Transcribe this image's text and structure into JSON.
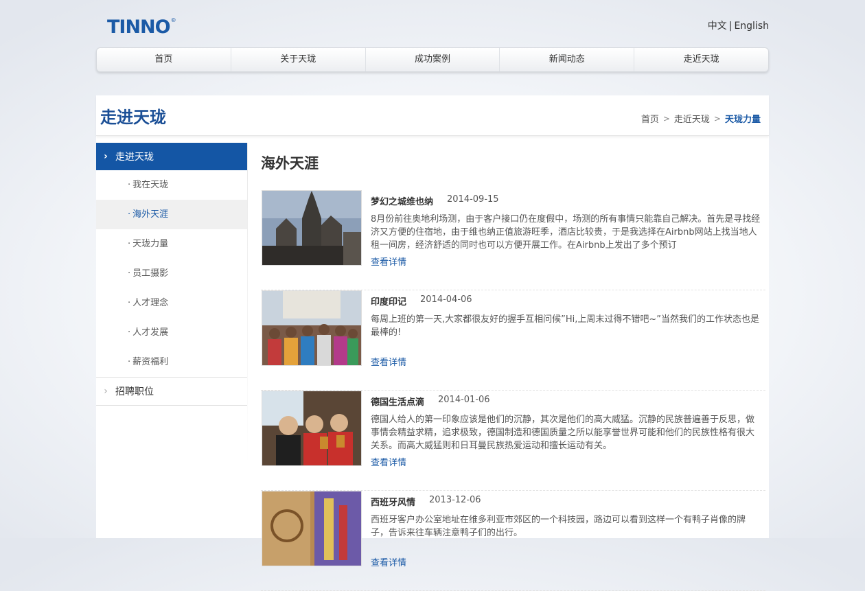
{
  "header": {
    "logo_text": "TINNO",
    "logo_reg": "®",
    "lang_zh": "中文",
    "lang_sep": "|",
    "lang_en": "English"
  },
  "nav": [
    "首页",
    "关于天珑",
    "成功案例",
    "新闻动态",
    "走近天珑"
  ],
  "section": {
    "title": "走进天珑",
    "breadcrumb": [
      "首页",
      "走近天珑",
      "天珑力量"
    ],
    "breadcrumb_sep": ">"
  },
  "sidebar": {
    "active": "走进天珑",
    "items": [
      "我在天珑",
      "海外天涯",
      "天珑力量",
      "员工摄影",
      "人才理念",
      "人才发展",
      "薪资福利"
    ],
    "selected_index": 1,
    "bullet": "·",
    "collapsed": "招聘职位"
  },
  "content": {
    "title": "海外天涯",
    "more_label": "查看详情",
    "articles": [
      {
        "title": "梦幻之城维也纳",
        "date": "2014-09-15",
        "summary": "8月份前往奥地利场测，由于客户接口仍在度假中，场测的所有事情只能靠自己解决。首先是寻找经济又方便的住宿地，由于维也纳正值旅游旺季，酒店比较贵，于是我选择在Airbnb网站上找当地人租一间房，经济舒适的同时也可以方便开展工作。在Airbnb上发出了多个预订"
      },
      {
        "title": "印度印记",
        "date": "2014-04-06",
        "summary": "每周上班的第一天,大家都很友好的握手互相问候”Hi,上周末过得不错吧~”当然我们的工作状态也是最棒的!"
      },
      {
        "title": "德国生活点滴",
        "date": "2014-01-06",
        "summary": "德国人给人的第一印象应该是他们的沉静，其次是他们的高大威猛。沉静的民族普遍善于反思，做事情会精益求精，追求极致，德国制造和德国质量之所以能享誉世界可能和他们的民族性格有很大关系。而高大威猛则和日耳曼民族热爱运动和擅长运动有关。"
      },
      {
        "title": "西班牙风情",
        "date": "2013-12-06",
        "summary": "西班牙客户办公室地址在维多利亚市郊区的一个科技园，路边可以看到这样一个有鸭子肖像的牌子，告诉来往车辆注意鸭子们的出行。"
      }
    ]
  }
}
